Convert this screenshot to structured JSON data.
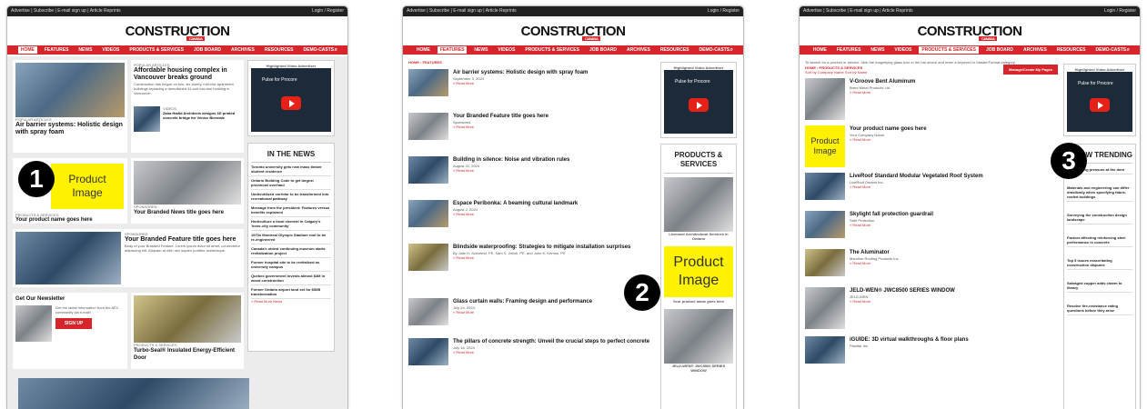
{
  "site": {
    "logo": "CONSTRUCTION",
    "logo_sub": "CANADA",
    "topbar_links": "Advertise | Subscribe | E-mail sign up | Article Reprints",
    "login": "Login / Register"
  },
  "nav": [
    "HOME",
    "FEATURES",
    "NEWS",
    "VIDEOS",
    "PRODUCTS & SERVICES",
    "JOB BOARD",
    "ARCHIVES",
    "RESOURCES",
    "DEMO-CASTS"
  ],
  "badges": {
    "one": "1",
    "two": "2",
    "three": "3"
  },
  "product_image": {
    "line1": "Product",
    "line2": "Image"
  },
  "ad": {
    "label": "Highlighted Video Advertiser",
    "video_title": "Pulse for Procore"
  },
  "p1": {
    "popular": "POPULAR ARTICLES",
    "hero_title": "Air barrier systems: Holistic design with spray foam",
    "vc_title": "Affordable housing complex in Vancouver breaks ground",
    "vc_text": "Construction has begun on two, six-storey, mid-rise apartment buildings replacing a demolished 44-unit low-rise building in Vancouver.",
    "videos": "VIDEOS",
    "zaha": "Zaha Hadid Architects designs 3D printed concrete bridge for Venice Biennale",
    "ps_label": "PRODUCTS & SERVICES",
    "ps_title": "Your product name goes here",
    "sponsored": "SPONSORED",
    "branded_news": "Your Branded News title goes here",
    "in_news": "IN THE NEWS",
    "news": [
      "Toronto university gets new mass timber student residence",
      "Ontario Building Code to get largest provincial overhaul",
      "Underutilized corridor to be transformed into recreational pathway",
      "Message from the president: Features versus benefits explained",
      "Horticulture a focal element in Calgary's 'inner-city community'",
      "1970s Montreal Olympic Stadium roof to be re-engineered",
      "Canada's oldest continuing museum starts revitalization project",
      "Former hospital site to be revitalized as university campus",
      "Quebec government invests almost $3M in wood construction",
      "Former Ontario airport land set for $50B transformation"
    ],
    "read_more_news": "» Read More News",
    "feat_label": "SPONSORED",
    "feat_title": "Your Branded Feature title goes here",
    "feat_text": "Body of your Branded Feature. Lorem ipsum dolor sit amet, consectetur adipiscing elit. Aliquam at nibh nec sapien porttitor scelerisque.",
    "newsletter": "Get Our Newsletter",
    "nl_text": "Get the latest information from the AEC community via e-mail!",
    "signup": "SIGN UP",
    "turbo_label": "PRODUCTS & SERVICES",
    "turbo": "Turbo-Seal® Insulated Energy-Efficient Door"
  },
  "p2": {
    "crumb": "HOME › FEATURES",
    "articles": [
      {
        "t": "Air barrier systems: Holistic design with spray foam",
        "d": "September 3, 2024"
      },
      {
        "t": "Your Branded Feature title goes here",
        "d": "Sponsored"
      },
      {
        "t": "Building in silence: Noise and vibration rules",
        "d": "August 21, 2024"
      },
      {
        "t": "Espace Peribonka: A beaming cultural landmark",
        "d": "August 2, 2024"
      },
      {
        "t": "Blindside waterproofing: Strategies to mitigate installation surprises",
        "d": "By Julie H. Schofield, PE, Sam S. Zelick, PE, and John K. Kerrins, PE"
      },
      {
        "t": "Glass curtain walls: Framing design and performance",
        "d": "July 24, 2024"
      },
      {
        "t": "The pillars of concrete strength: Unveil the crucial steps to perfect concrete",
        "d": "July 16, 2024"
      }
    ],
    "read_more": "» Read More",
    "ps_title": "PRODUCTS & SERVICES",
    "licensed": "Licensed Architectural Services in Ontario",
    "product_caption": "Your product name goes here",
    "jeld": "JELD-WEN® JWC8500 SERIES WINDOW"
  },
  "p3": {
    "search_tip": "To search for a product or service, click the magnifying glass icon in the bar above and enter a keyword or Master/Format category.",
    "crumb": "HOME › PRODUCTS & SERVICES",
    "sort": "Sort by Company Name   Sort by Name",
    "manage": "Manage/Create My Pages",
    "products": [
      {
        "t": "V-Groove Bent Aluminum",
        "s": "Brent Metal Products Ltd."
      },
      {
        "t": "Your product name goes here",
        "s": "Your Company Name"
      },
      {
        "t": "LiveRoof Standard Modular Vegetated Roof System",
        "s": "LiveRoof Ontario Inc."
      },
      {
        "t": "Skylight fall protection guardrail",
        "s": "Safe Protection"
      },
      {
        "t": "The Aluminator",
        "s": "Maroline Roofing Products Inc."
      },
      {
        "t": "JELD-WEN® JWC8500 SERIES WINDOW",
        "s": "JELD-WEN"
      },
      {
        "t": "iGUIDE: 3D virtual walkthroughs & floor plans",
        "s": "Planitar Inc."
      }
    ],
    "trending": "NOW TRENDING",
    "trend": [
      "Fall building pressure at the door",
      "Materials and engineering can differ drastically when specifying fabric-roofed buildings",
      "Surveying the construction design landscape",
      "Factors affecting reinforcing steel performance in concrete",
      "Top 5 issues exacerbating construction disputes",
      "Salvaged copper adds charm to library",
      "Resolve fire-resistance rating questions before they arise"
    ]
  }
}
